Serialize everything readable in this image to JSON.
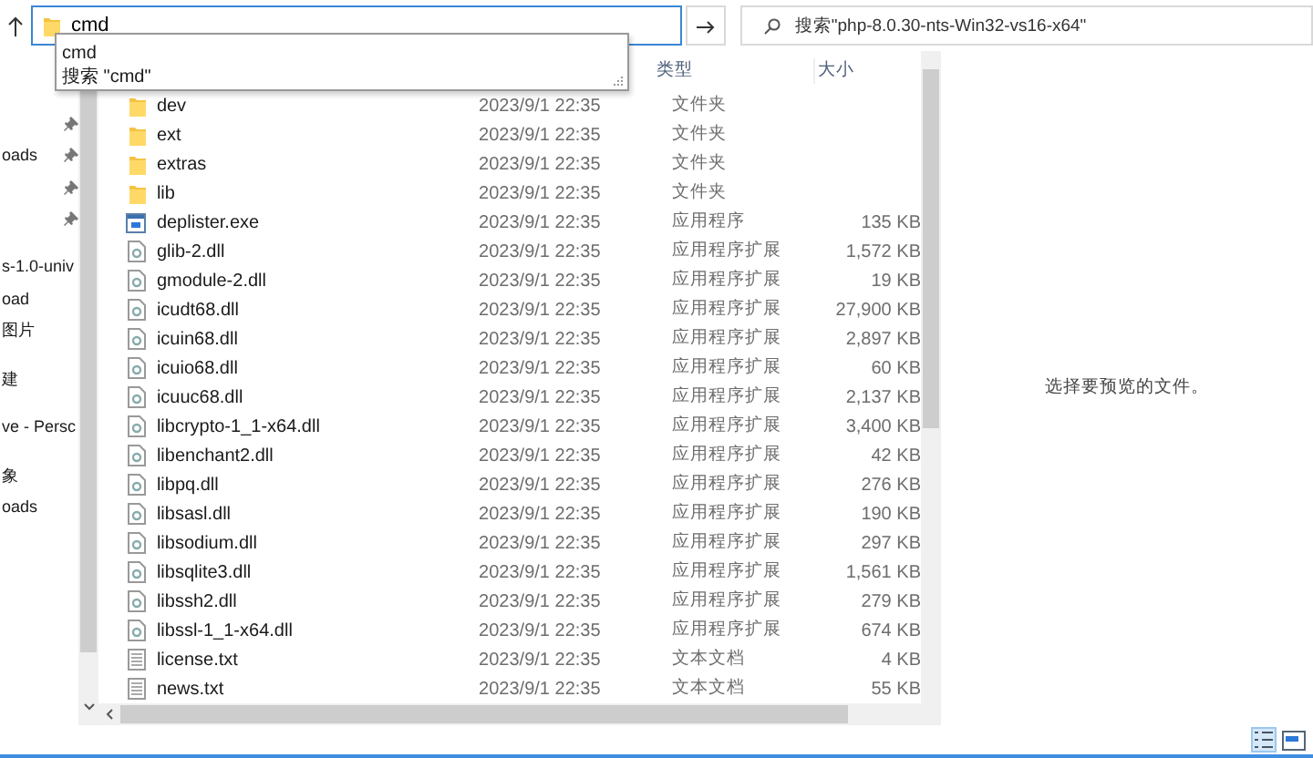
{
  "address_bar": {
    "value": "cmd",
    "suggestions": [
      "cmd",
      "搜索 \"cmd\""
    ]
  },
  "search": {
    "placeholder": "搜索\"php-8.0.30-nts-Win32-vs16-x64\""
  },
  "sidebar": {
    "groups": [
      [
        {
          "pinned": true
        },
        {
          "label": "oads",
          "pinned": true
        },
        {
          "pinned": true
        },
        {
          "pinned": true
        }
      ],
      [
        {
          "label": "s-1.0-univ",
          "pinned": false
        },
        {
          "label": "oad",
          "pinned": false
        },
        {
          "label": "图片",
          "pinned": false
        }
      ],
      [
        {
          "label": "建",
          "pinned": false
        }
      ],
      [
        {
          "label": "ve - Persc",
          "pinned": false
        }
      ],
      [
        {
          "label": "象",
          "pinned": false
        },
        {
          "label": "oads",
          "pinned": false
        }
      ]
    ]
  },
  "table": {
    "columns": [
      "类型",
      "大小"
    ],
    "rows": [
      {
        "kind": "folder",
        "name": "dev",
        "date": "2023/9/1 22:35",
        "type": "文件夹",
        "size": ""
      },
      {
        "kind": "folder",
        "name": "ext",
        "date": "2023/9/1 22:35",
        "type": "文件夹"
      },
      {
        "kind": "folder",
        "name": "extras",
        "date": "2023/9/1 22:35",
        "type": "文件夹"
      },
      {
        "kind": "folder",
        "name": "lib",
        "date": "2023/9/1 22:35",
        "type": "文件夹"
      },
      {
        "kind": "exe",
        "name": "deplister.exe",
        "date": "2023/9/1 22:35",
        "type": "应用程序",
        "size": "135 KB"
      },
      {
        "kind": "dll",
        "name": "glib-2.dll",
        "date": "2023/9/1 22:35",
        "type": "应用程序扩展",
        "size": "1,572 KB"
      },
      {
        "kind": "dll",
        "name": "gmodule-2.dll",
        "date": "2023/9/1 22:35",
        "type": "应用程序扩展",
        "size": "19 KB"
      },
      {
        "kind": "dll",
        "name": "icudt68.dll",
        "date": "2023/9/1 22:35",
        "type": "应用程序扩展",
        "size": "27,900 KB"
      },
      {
        "kind": "dll",
        "name": "icuin68.dll",
        "date": "2023/9/1 22:35",
        "type": "应用程序扩展",
        "size": "2,897 KB"
      },
      {
        "kind": "dll",
        "name": "icuio68.dll",
        "date": "2023/9/1 22:35",
        "type": "应用程序扩展",
        "size": "60 KB"
      },
      {
        "kind": "dll",
        "name": "icuuc68.dll",
        "date": "2023/9/1 22:35",
        "type": "应用程序扩展",
        "size": "2,137 KB"
      },
      {
        "kind": "dll",
        "name": "libcrypto-1_1-x64.dll",
        "date": "2023/9/1 22:35",
        "type": "应用程序扩展",
        "size": "3,400 KB"
      },
      {
        "kind": "dll",
        "name": "libenchant2.dll",
        "date": "2023/9/1 22:35",
        "type": "应用程序扩展",
        "size": "42 KB"
      },
      {
        "kind": "dll",
        "name": "libpq.dll",
        "date": "2023/9/1 22:35",
        "type": "应用程序扩展",
        "size": "276 KB"
      },
      {
        "kind": "dll",
        "name": "libsasl.dll",
        "date": "2023/9/1 22:35",
        "type": "应用程序扩展",
        "size": "190 KB"
      },
      {
        "kind": "dll",
        "name": "libsodium.dll",
        "date": "2023/9/1 22:35",
        "type": "应用程序扩展",
        "size": "297 KB"
      },
      {
        "kind": "dll",
        "name": "libsqlite3.dll",
        "date": "2023/9/1 22:35",
        "type": "应用程序扩展",
        "size": "1,561 KB"
      },
      {
        "kind": "dll",
        "name": "libssh2.dll",
        "date": "2023/9/1 22:35",
        "type": "应用程序扩展",
        "size": "279 KB"
      },
      {
        "kind": "dll",
        "name": "libssl-1_1-x64.dll",
        "date": "2023/9/1 22:35",
        "type": "应用程序扩展",
        "size": "674 KB"
      },
      {
        "kind": "txt",
        "name": "license.txt",
        "date": "2023/9/1 22:35",
        "type": "文本文档",
        "size": "4 KB"
      },
      {
        "kind": "txt",
        "name": "news.txt",
        "date": "2023/9/1 22:35",
        "type": "文本文档",
        "size": "55 KB"
      }
    ]
  },
  "preview": {
    "message": "选择要预览的文件。"
  }
}
